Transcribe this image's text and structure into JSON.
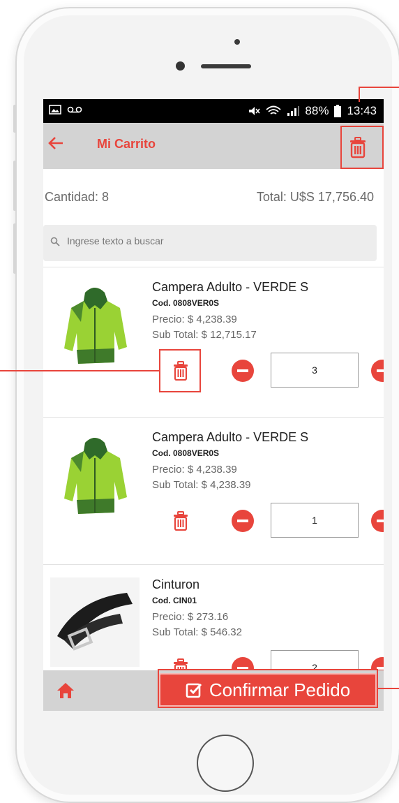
{
  "status_bar": {
    "battery": "88%",
    "time": "13:43"
  },
  "app_bar": {
    "title": "Mi Carrito",
    "back_icon": "back-arrow-icon",
    "delete_all_icon": "trash-icon"
  },
  "summary": {
    "quantity": "Cantidad: 8",
    "total": "Total: U$S 17,756.40"
  },
  "search": {
    "placeholder": "Ingrese texto a buscar"
  },
  "items": [
    {
      "name": "Campera Adulto - VERDE S",
      "code": "Cod. 0808VER0S",
      "price": "Precio: $ 4,238.39",
      "subtotal": "Sub Total: $ 12,715.17",
      "quantity": "3"
    },
    {
      "name": "Campera Adulto - VERDE S",
      "code": "Cod. 0808VER0S",
      "price": "Precio: $ 4,238.39",
      "subtotal": "Sub Total: $ 4,238.39",
      "quantity": "1"
    },
    {
      "name": "Cinturon",
      "code": "Cod. CIN01",
      "price": "Precio: $ 273.16",
      "subtotal": "Sub Total: $ 546.32",
      "quantity": "2"
    }
  ],
  "bottom_bar": {
    "home_icon": "home-icon",
    "confirm_label": "Confirmar Pedido"
  },
  "colors": {
    "accent": "#e8453c",
    "appbar": "#d3d3d3"
  }
}
